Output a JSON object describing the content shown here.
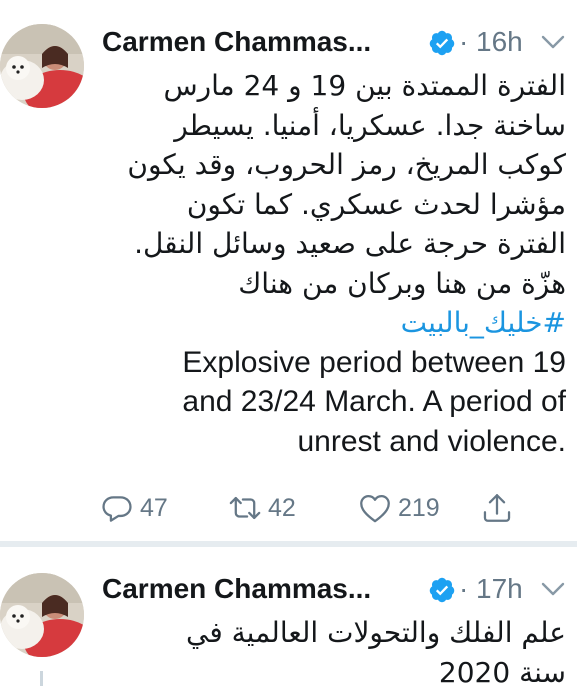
{
  "tweets": [
    {
      "author": "Carmen Chammas...",
      "time": "16h",
      "dot": "·",
      "text_ar_lines": [
        "الفترة الممتدة بين 19 و 24 مارس",
        "ساخنة جدا. عسكريا، أمنيا. يسيطر",
        "كوكب المريخ، رمز الحروب، وقد يكون",
        "مؤشرا لحدث عسكري. كما تكون",
        "الفترة حرجة على صعيد وسائل النقل.",
        "هزّة من هنا وبركان من هناك"
      ],
      "hashtag": "#خليك_بالبيت",
      "text_en_lines": [
        "Explosive period between 19",
        "and 23/24 March. A period of",
        ".unrest and violence"
      ],
      "replies": "47",
      "retweets": "42",
      "likes": "219"
    },
    {
      "author": "Carmen Chammas...",
      "time": "17h",
      "dot": "·",
      "text_ar_lines": [
        "علم الفلك والتحولات العالمية في",
        "سنة 2020"
      ]
    }
  ],
  "icons": {
    "verified": "verified-badge-icon",
    "chevron": "chevron-down-icon",
    "reply": "reply-icon",
    "retweet": "retweet-icon",
    "like": "heart-icon",
    "share": "share-icon"
  },
  "colors": {
    "accent": "#1b95e0",
    "muted": "#657786",
    "text": "#14171a",
    "separator": "#e6ecf0"
  }
}
